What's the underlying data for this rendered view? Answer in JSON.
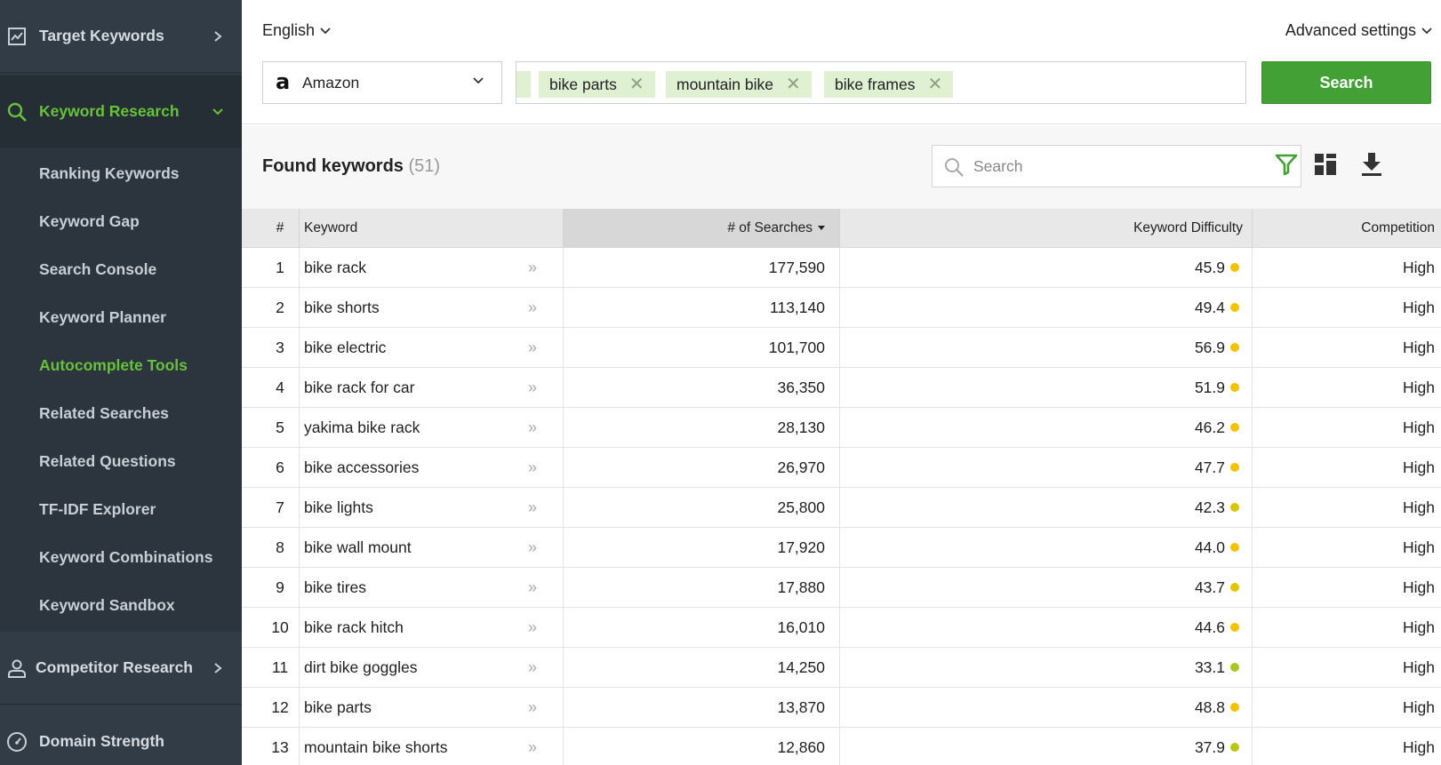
{
  "sidebar": {
    "sections": [
      {
        "label": "Target Keywords",
        "icon": "chart-icon"
      },
      {
        "label": "Keyword Research",
        "icon": "search-icon"
      },
      {
        "label": "Competitor Research",
        "icon": "user-icon"
      },
      {
        "label": "Domain Strength",
        "icon": "gauge-icon"
      }
    ],
    "items": [
      {
        "label": "Ranking Keywords"
      },
      {
        "label": "Keyword Gap"
      },
      {
        "label": "Search Console"
      },
      {
        "label": "Keyword Planner"
      },
      {
        "label": "Autocomplete Tools"
      },
      {
        "label": "Related Searches"
      },
      {
        "label": "Related Questions"
      },
      {
        "label": "TF-IDF Explorer"
      },
      {
        "label": "Keyword Combinations"
      },
      {
        "label": "Keyword Sandbox"
      }
    ]
  },
  "header": {
    "language": "English",
    "advanced": "Advanced settings",
    "engine": "Amazon",
    "engine_glyph": "a",
    "tags": [
      "bike parts",
      "mountain bike",
      "bike frames"
    ],
    "tag_remove": "✕",
    "search_button": "Search"
  },
  "found": {
    "title": "Found keywords",
    "count": "(51)",
    "search_placeholder": "Search"
  },
  "table": {
    "columns": {
      "num": "#",
      "keyword": "Keyword",
      "searches": "# of Searches",
      "difficulty": "Keyword Difficulty",
      "competition": "Competition"
    },
    "more_glyph": "»",
    "rows": [
      {
        "n": "1",
        "keyword": "bike rack",
        "searches": "177,590",
        "difficulty": "45.9",
        "competition": "High",
        "dot": "#f2c200"
      },
      {
        "n": "2",
        "keyword": "bike shorts",
        "searches": "113,140",
        "difficulty": "49.4",
        "competition": "High",
        "dot": "#f2c200"
      },
      {
        "n": "3",
        "keyword": "bike electric",
        "searches": "101,700",
        "difficulty": "56.9",
        "competition": "High",
        "dot": "#f2c200"
      },
      {
        "n": "4",
        "keyword": "bike rack for car",
        "searches": "36,350",
        "difficulty": "51.9",
        "competition": "High",
        "dot": "#f2c200"
      },
      {
        "n": "5",
        "keyword": "yakima bike rack",
        "searches": "28,130",
        "difficulty": "46.2",
        "competition": "High",
        "dot": "#f2c200"
      },
      {
        "n": "6",
        "keyword": "bike accessories",
        "searches": "26,970",
        "difficulty": "47.7",
        "competition": "High",
        "dot": "#f2c200"
      },
      {
        "n": "7",
        "keyword": "bike lights",
        "searches": "25,800",
        "difficulty": "42.3",
        "competition": "High",
        "dot": "#d6c800"
      },
      {
        "n": "8",
        "keyword": "bike wall mount",
        "searches": "17,920",
        "difficulty": "44.0",
        "competition": "High",
        "dot": "#f2c200"
      },
      {
        "n": "9",
        "keyword": "bike tires",
        "searches": "17,880",
        "difficulty": "43.7",
        "competition": "High",
        "dot": "#e0c600"
      },
      {
        "n": "10",
        "keyword": "bike rack hitch",
        "searches": "16,010",
        "difficulty": "44.6",
        "competition": "High",
        "dot": "#f2c200"
      },
      {
        "n": "11",
        "keyword": "dirt bike goggles",
        "searches": "14,250",
        "difficulty": "33.1",
        "competition": "High",
        "dot": "#a8c624"
      },
      {
        "n": "12",
        "keyword": "bike parts",
        "searches": "13,870",
        "difficulty": "48.8",
        "competition": "High",
        "dot": "#f2c200"
      },
      {
        "n": "13",
        "keyword": "mountain bike shorts",
        "searches": "12,860",
        "difficulty": "37.9",
        "competition": "High",
        "dot": "#b8c51a"
      }
    ]
  },
  "colors": {
    "accent": "#67c23a",
    "button": "#43a035",
    "sidebar": "#2f3841",
    "tag": "#dff0d3"
  }
}
